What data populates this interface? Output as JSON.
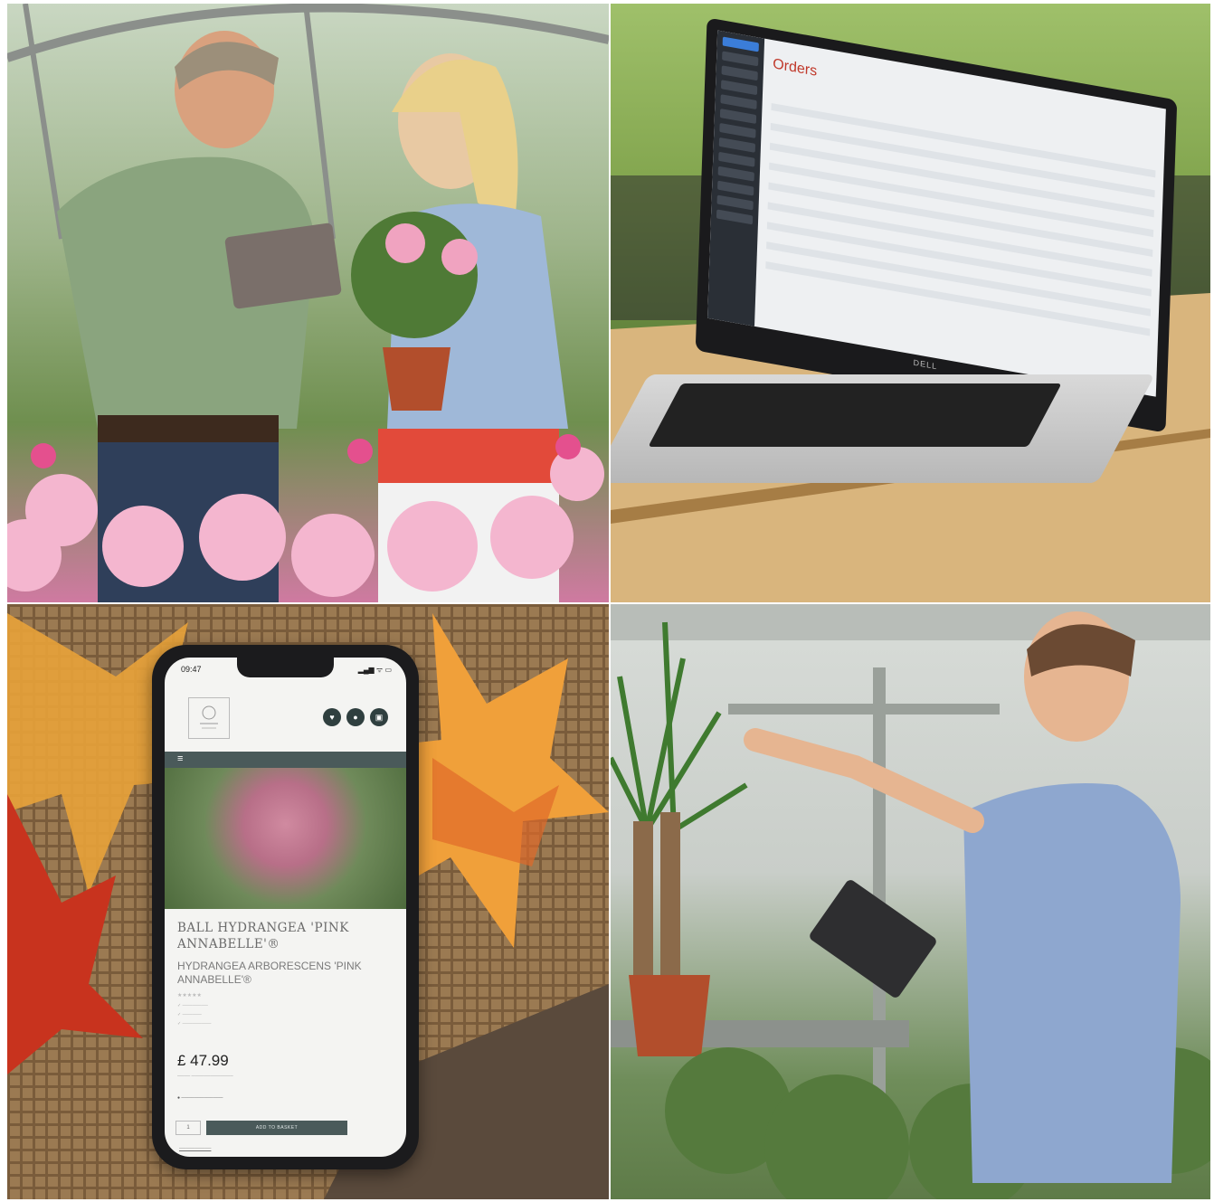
{
  "collage": {
    "panels": [
      {
        "id": "top-left",
        "subject": "two people in a garden centre with a tablet and pink geraniums"
      },
      {
        "id": "top-right",
        "subject": "laptop showing an orders dashboard"
      },
      {
        "id": "bottom-left",
        "subject": "smartphone on burlap with autumn leaves showing a plant product page"
      },
      {
        "id": "bottom-right",
        "subject": "man with tablet touching a yucca plant in a greenhouse"
      }
    ]
  },
  "laptop": {
    "screen_title": "Orders",
    "brand": "DELL"
  },
  "phone": {
    "status_time": "09:47",
    "status_icons": "▂▄▆ ᯤ ▭",
    "logo_text": "",
    "header_icons": [
      "heart-icon",
      "user-icon",
      "basket-icon"
    ],
    "menu_glyph": "≡",
    "product_title": "BALL HYDRANGEA 'PINK ANNABELLE'®",
    "product_subtitle": "HYDRANGEA ARBORESCENS 'PINK ANNABELLE'®",
    "price": "£ 47.99",
    "add_to_basket": "ADD TO BASKET",
    "qty": "1"
  },
  "colors": {
    "phone_nav": "#4a5a5a",
    "orders_red": "#c0392b"
  }
}
